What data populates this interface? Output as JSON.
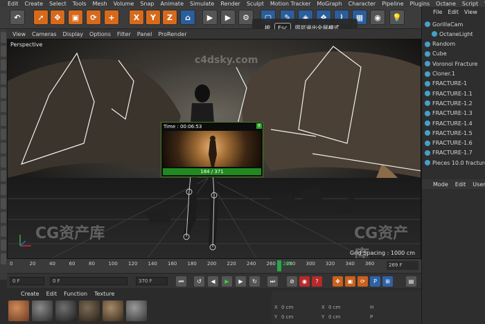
{
  "menubar": {
    "items": [
      "Edit",
      "Create",
      "Select",
      "Tools",
      "Mesh",
      "Volume",
      "Snap",
      "Animate",
      "Simulate",
      "Render",
      "Sculpt",
      "Motion Tracker",
      "MoGraph",
      "Character",
      "Pipeline",
      "Plugins",
      "Octane",
      "Script",
      "Window"
    ]
  },
  "toolbar": {
    "x_label": "X",
    "y_label": "Y",
    "z_label": "Z"
  },
  "tooltip": {
    "prefix": "按",
    "key": "Esc",
    "suffix": "即可退出全屏模式"
  },
  "viewport": {
    "menu": [
      "View",
      "Cameras",
      "Display",
      "Options",
      "Filter",
      "Panel",
      "ProRender"
    ],
    "label": "Perspective",
    "grid_spacing": "Grid Spacing : 1000 cm",
    "watermark_left": "CG资产库",
    "watermark_right": "CG资产库",
    "watermark_center": "c4dsky.com"
  },
  "preview": {
    "time": "Time : 00:06:53",
    "frames": "184 / 371",
    "close": "X"
  },
  "timeline": {
    "ticks": [
      "0",
      "20",
      "40",
      "60",
      "80",
      "100",
      "120",
      "140",
      "160",
      "180",
      "200",
      "220",
      "240",
      "260",
      "280",
      "300",
      "320",
      "340",
      "360"
    ],
    "current_frame": "269",
    "frame_field": "269 F"
  },
  "playback": {
    "start": "0 F",
    "range_start": "0 F",
    "range_end": "370 F",
    "end": "370 F"
  },
  "materials": {
    "menu": [
      "Create",
      "Edit",
      "Function",
      "Texture"
    ]
  },
  "coords": {
    "x": "X",
    "y": "Y",
    "z": "Z",
    "h": "H",
    "p": "P",
    "b": "B",
    "x_val": "0 cm",
    "y_val": "0 cm",
    "z_val": "0 cm"
  },
  "object_manager": {
    "menu": [
      "File",
      "Edit",
      "View"
    ],
    "items": [
      "GorillaCam",
      "OctaneLight",
      "Random",
      "Cube",
      "Voronoi Fracture",
      "Cloner.1",
      "FRACTURE-1",
      "FRACTURE-1.1",
      "FRACTURE-1.2",
      "FRACTURE-1.3",
      "FRACTURE-1.4",
      "FRACTURE-1.5",
      "FRACTURE-1.6",
      "FRACTURE-1.7",
      "Pieces 10.0 fracture"
    ]
  },
  "attributes": {
    "menu": [
      "Mode",
      "Edit",
      "User"
    ]
  },
  "colors": {
    "accent": "#d66a1c",
    "playhead": "#26a84a",
    "preview_bar": "#1f8a1f"
  }
}
